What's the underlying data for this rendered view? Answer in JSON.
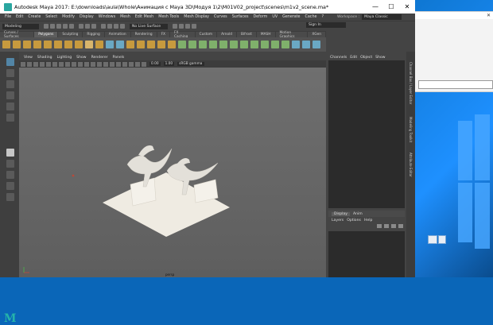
{
  "window": {
    "title": "Autodesk Maya 2017: E:\\downloads\\aula\\Whole\\Анимация с Maya 3D\\Модуя 1\\2\\M01V02_project\\scenes\\m1v2_scene.ma*",
    "minimize": "—",
    "maximize": "☐",
    "close": "✕"
  },
  "menu": [
    "File",
    "Edit",
    "Create",
    "Select",
    "Modify",
    "Display",
    "Windows",
    "Mesh",
    "Edit Mesh",
    "Mesh Tools",
    "Mesh Display",
    "Curves",
    "Surfaces",
    "Deform",
    "UV",
    "Generate",
    "Cache",
    "?"
  ],
  "workspace": {
    "label": "Workspace :",
    "value": "Maya Classic"
  },
  "status": {
    "mode": "Modeling",
    "live_surface": "No Live Surface",
    "sign_in": "Sign In"
  },
  "shelf_tabs": [
    "Curves / Surfaces",
    "Polygons",
    "Sculpting",
    "Rigging",
    "Animation",
    "Rendering",
    "FX",
    "FX Caching",
    "Custom",
    "Arnold",
    "Bifrost",
    "MASH",
    "Motion Graphics",
    "XGen"
  ],
  "shelf_active": "Polygons",
  "panel_menu": [
    "View",
    "Shading",
    "Lighting",
    "Show",
    "Renderer",
    "Panels"
  ],
  "panel_values": {
    "near": "0.00",
    "far": "1.00",
    "color_space": "sRGB gamma"
  },
  "viewport_label": "persp",
  "right_tabs": [
    "Channels",
    "Edit",
    "Object",
    "Show"
  ],
  "layer_tabs": [
    "Display",
    "Anim"
  ],
  "layer_active": "Display",
  "layer_menu": [
    "Layers",
    "Options",
    "Help"
  ],
  "side_tabs": [
    "Channel Box / Layer Editor",
    "Modeling Toolkit",
    "Attribute Editor"
  ],
  "maya_logo": "M",
  "colors": {
    "accent": "#2aa6a0",
    "selected_tool": "#5285a6",
    "desktop": "#0f78d4"
  }
}
